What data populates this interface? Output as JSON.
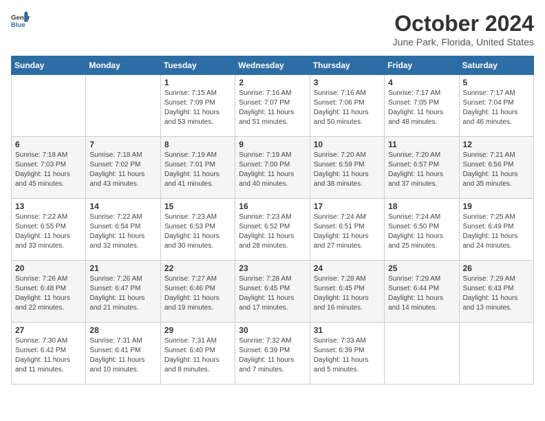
{
  "header": {
    "logo_line1": "General",
    "logo_line2": "Blue",
    "month": "October 2024",
    "location": "June Park, Florida, United States"
  },
  "weekdays": [
    "Sunday",
    "Monday",
    "Tuesday",
    "Wednesday",
    "Thursday",
    "Friday",
    "Saturday"
  ],
  "weeks": [
    [
      {
        "day": "",
        "info": ""
      },
      {
        "day": "",
        "info": ""
      },
      {
        "day": "1",
        "info": "Sunrise: 7:15 AM\nSunset: 7:09 PM\nDaylight: 11 hours and 53 minutes."
      },
      {
        "day": "2",
        "info": "Sunrise: 7:16 AM\nSunset: 7:07 PM\nDaylight: 11 hours and 51 minutes."
      },
      {
        "day": "3",
        "info": "Sunrise: 7:16 AM\nSunset: 7:06 PM\nDaylight: 11 hours and 50 minutes."
      },
      {
        "day": "4",
        "info": "Sunrise: 7:17 AM\nSunset: 7:05 PM\nDaylight: 11 hours and 48 minutes."
      },
      {
        "day": "5",
        "info": "Sunrise: 7:17 AM\nSunset: 7:04 PM\nDaylight: 11 hours and 46 minutes."
      }
    ],
    [
      {
        "day": "6",
        "info": "Sunrise: 7:18 AM\nSunset: 7:03 PM\nDaylight: 11 hours and 45 minutes."
      },
      {
        "day": "7",
        "info": "Sunrise: 7:18 AM\nSunset: 7:02 PM\nDaylight: 11 hours and 43 minutes."
      },
      {
        "day": "8",
        "info": "Sunrise: 7:19 AM\nSunset: 7:01 PM\nDaylight: 11 hours and 41 minutes."
      },
      {
        "day": "9",
        "info": "Sunrise: 7:19 AM\nSunset: 7:00 PM\nDaylight: 11 hours and 40 minutes."
      },
      {
        "day": "10",
        "info": "Sunrise: 7:20 AM\nSunset: 6:59 PM\nDaylight: 11 hours and 38 minutes."
      },
      {
        "day": "11",
        "info": "Sunrise: 7:20 AM\nSunset: 6:57 PM\nDaylight: 11 hours and 37 minutes."
      },
      {
        "day": "12",
        "info": "Sunrise: 7:21 AM\nSunset: 6:56 PM\nDaylight: 11 hours and 35 minutes."
      }
    ],
    [
      {
        "day": "13",
        "info": "Sunrise: 7:22 AM\nSunset: 6:55 PM\nDaylight: 11 hours and 33 minutes."
      },
      {
        "day": "14",
        "info": "Sunrise: 7:22 AM\nSunset: 6:54 PM\nDaylight: 11 hours and 32 minutes."
      },
      {
        "day": "15",
        "info": "Sunrise: 7:23 AM\nSunset: 6:53 PM\nDaylight: 11 hours and 30 minutes."
      },
      {
        "day": "16",
        "info": "Sunrise: 7:23 AM\nSunset: 6:52 PM\nDaylight: 11 hours and 28 minutes."
      },
      {
        "day": "17",
        "info": "Sunrise: 7:24 AM\nSunset: 6:51 PM\nDaylight: 11 hours and 27 minutes."
      },
      {
        "day": "18",
        "info": "Sunrise: 7:24 AM\nSunset: 6:50 PM\nDaylight: 11 hours and 25 minutes."
      },
      {
        "day": "19",
        "info": "Sunrise: 7:25 AM\nSunset: 6:49 PM\nDaylight: 11 hours and 24 minutes."
      }
    ],
    [
      {
        "day": "20",
        "info": "Sunrise: 7:26 AM\nSunset: 6:48 PM\nDaylight: 11 hours and 22 minutes."
      },
      {
        "day": "21",
        "info": "Sunrise: 7:26 AM\nSunset: 6:47 PM\nDaylight: 11 hours and 21 minutes."
      },
      {
        "day": "22",
        "info": "Sunrise: 7:27 AM\nSunset: 6:46 PM\nDaylight: 11 hours and 19 minutes."
      },
      {
        "day": "23",
        "info": "Sunrise: 7:28 AM\nSunset: 6:45 PM\nDaylight: 11 hours and 17 minutes."
      },
      {
        "day": "24",
        "info": "Sunrise: 7:28 AM\nSunset: 6:45 PM\nDaylight: 11 hours and 16 minutes."
      },
      {
        "day": "25",
        "info": "Sunrise: 7:29 AM\nSunset: 6:44 PM\nDaylight: 11 hours and 14 minutes."
      },
      {
        "day": "26",
        "info": "Sunrise: 7:29 AM\nSunset: 6:43 PM\nDaylight: 11 hours and 13 minutes."
      }
    ],
    [
      {
        "day": "27",
        "info": "Sunrise: 7:30 AM\nSunset: 6:42 PM\nDaylight: 11 hours and 11 minutes."
      },
      {
        "day": "28",
        "info": "Sunrise: 7:31 AM\nSunset: 6:41 PM\nDaylight: 11 hours and 10 minutes."
      },
      {
        "day": "29",
        "info": "Sunrise: 7:31 AM\nSunset: 6:40 PM\nDaylight: 11 hours and 8 minutes."
      },
      {
        "day": "30",
        "info": "Sunrise: 7:32 AM\nSunset: 6:39 PM\nDaylight: 11 hours and 7 minutes."
      },
      {
        "day": "31",
        "info": "Sunrise: 7:33 AM\nSunset: 6:39 PM\nDaylight: 11 hours and 5 minutes."
      },
      {
        "day": "",
        "info": ""
      },
      {
        "day": "",
        "info": ""
      }
    ]
  ]
}
